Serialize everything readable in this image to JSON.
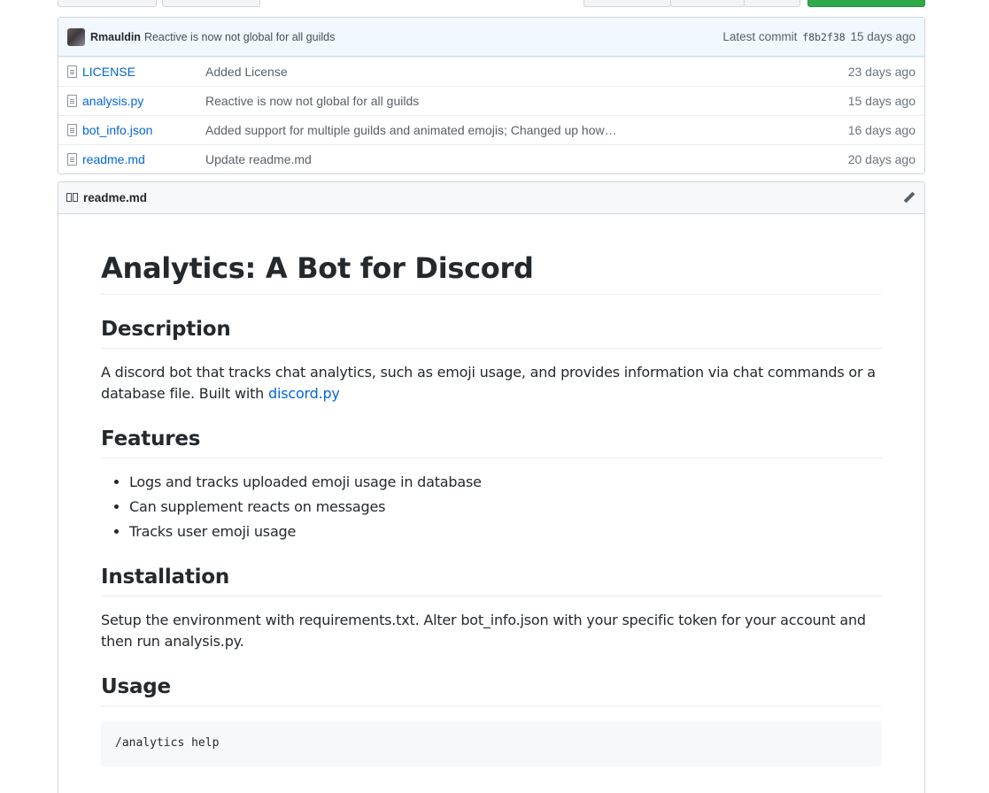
{
  "commit_bar": {
    "author": "Rmauldin",
    "message": "Reactive is now not global for all guilds",
    "latest_commit_label": "Latest commit",
    "sha": "f8b2f38",
    "age": "15 days ago"
  },
  "files": [
    {
      "name": "LICENSE",
      "message": "Added License",
      "age": "23 days ago"
    },
    {
      "name": "analysis.py",
      "message": "Reactive is now not global for all guilds",
      "age": "15 days ago"
    },
    {
      "name": "bot_info.json",
      "message": "Added support for multiple guilds and animated emojis; Changed up how…",
      "age": "16 days ago"
    },
    {
      "name": "readme.md",
      "message": "Update readme.md",
      "age": "20 days ago"
    }
  ],
  "readme": {
    "filename": "readme.md",
    "title": "Analytics: A Bot for Discord",
    "description_heading": "Description",
    "description_text": "A discord bot that tracks chat analytics, such as emoji usage, and provides information via chat commands or a database file. Built with",
    "description_link": "discord.py",
    "features_heading": "Features",
    "features": [
      "Logs and tracks uploaded emoji usage in database",
      "Can supplement reacts on messages",
      "Tracks user emoji usage"
    ],
    "installation_heading": "Installation",
    "installation_text": "Setup the environment with requirements.txt. Alter bot_info.json with your specific token for your account and then run analysis.py.",
    "usage_heading": "Usage",
    "usage_code": "/analytics help"
  },
  "icons": {
    "file": "file-icon",
    "book": "book-icon",
    "edit": "pencil-icon",
    "avatar": "avatar"
  },
  "colors": {
    "link": "#0366d6",
    "commit_bar_bg": "#f1f8ff",
    "clone_button": "#2fa94a"
  }
}
